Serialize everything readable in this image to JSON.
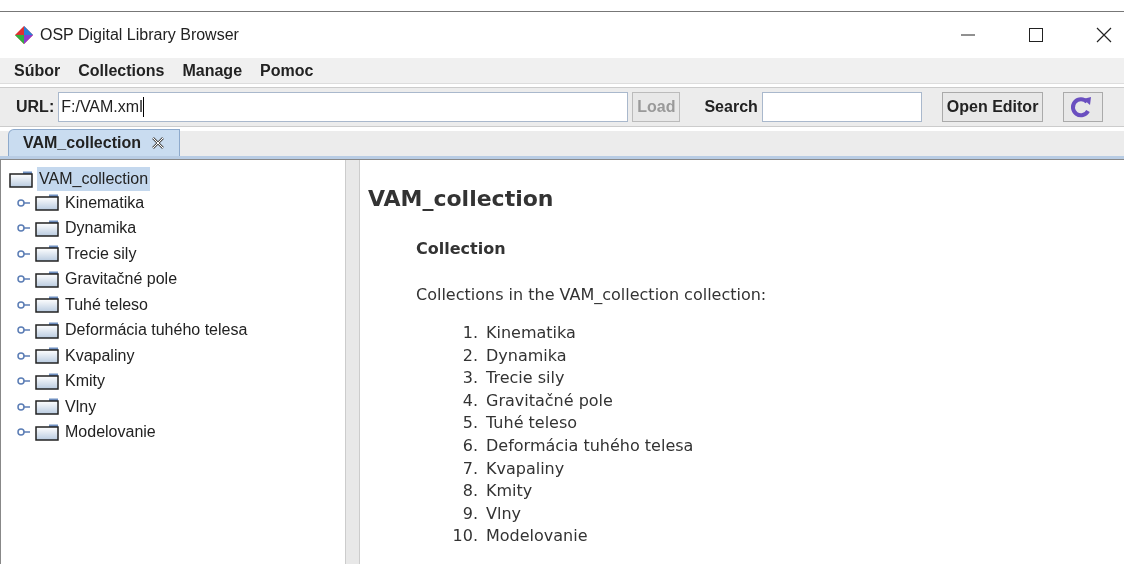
{
  "window": {
    "title": "OSP Digital Library Browser"
  },
  "menu": [
    "Súbor",
    "Collections",
    "Manage",
    "Pomoc"
  ],
  "toolbar": {
    "url_label": "URL:",
    "url_value": "F:/VAM.xml",
    "load": {
      "label": "Load",
      "disabled": true
    },
    "search_label": "Search",
    "open_editor": "Open Editor"
  },
  "tabs": [
    {
      "label": "VAM_collection",
      "selected": true
    }
  ],
  "tree": {
    "label": "VAM_collection",
    "selected": true,
    "children": [
      {
        "label": "Kinematika",
        "selected": false,
        "expanded": false
      },
      {
        "label": "Dynamika",
        "selected": false,
        "expanded": false
      },
      {
        "label": "Trecie sily",
        "selected": false,
        "expanded": false
      },
      {
        "label": "Gravitačné pole",
        "selected": false,
        "expanded": false
      },
      {
        "label": "Tuhé teleso",
        "selected": false,
        "expanded": false
      },
      {
        "label": "Deformácia tuhého telesa",
        "selected": false,
        "expanded": false
      },
      {
        "label": "Kvapaliny",
        "selected": false,
        "expanded": false
      },
      {
        "label": "Kmity",
        "selected": false,
        "expanded": false
      },
      {
        "label": "Vlny",
        "selected": false,
        "expanded": false
      },
      {
        "label": "Modelovanie",
        "selected": false,
        "expanded": false
      }
    ]
  },
  "content": {
    "title": "VAM_collection",
    "subtitle": "Collection",
    "intro": "Collections in the VAM_collection collection:",
    "list": [
      {
        "number": "1.",
        "label": "Kinematika"
      },
      {
        "number": "2.",
        "label": "Dynamika"
      },
      {
        "number": "3.",
        "label": "Trecie sily"
      },
      {
        "number": "4.",
        "label": "Gravitačné pole"
      },
      {
        "number": "5.",
        "label": "Tuhé teleso"
      },
      {
        "number": "6.",
        "label": "Deformácia tuhého telesa"
      },
      {
        "number": "7.",
        "label": "Kvapaliny"
      },
      {
        "number": "8.",
        "label": "Kmity"
      },
      {
        "number": "9.",
        "label": "Vlny"
      },
      {
        "number": "10.",
        "label": "Modelovanie"
      }
    ]
  }
}
